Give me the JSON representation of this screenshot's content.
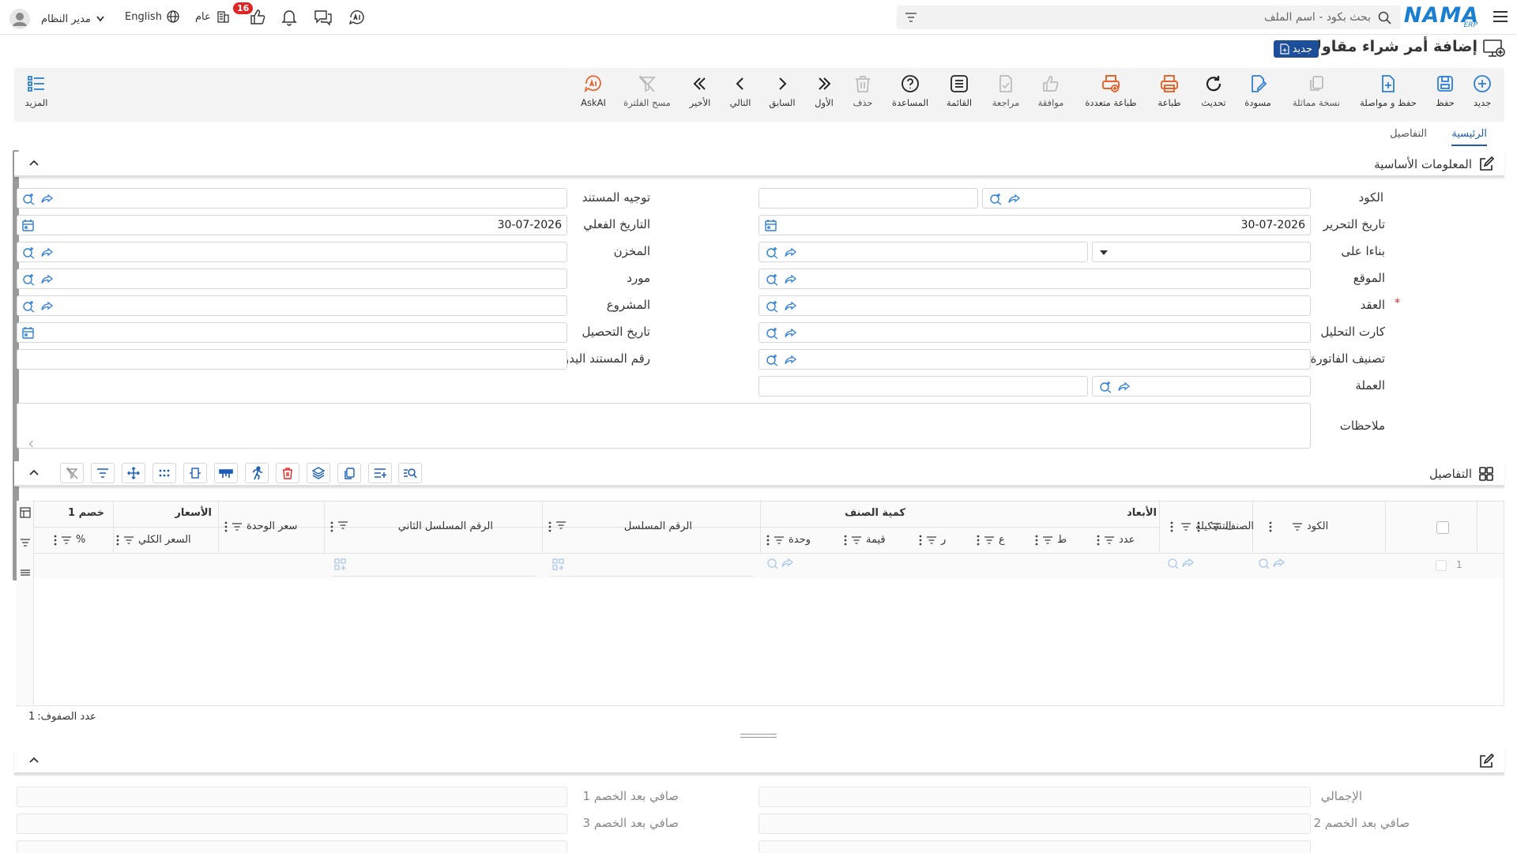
{
  "topbar": {
    "logo_text": "NAMA",
    "logo_sub": "ERP",
    "search_placeholder": "بحث بكود - اسم الملف",
    "user_name": "مدير النظام",
    "language": "English",
    "general_label": "عام",
    "notification_count": "16"
  },
  "page": {
    "title": "إضافة أمر شراء مقاولات",
    "badge": "جديد"
  },
  "toolbar": {
    "new": "جديد",
    "save": "حفظ",
    "save_continue": "حفظ و مواصلة",
    "copy": "نسخة مماثلة",
    "draft": "مسودة",
    "refresh": "تحديث",
    "print": "طباعة",
    "multi_print": "طباعة متعددة",
    "approve": "موافقة",
    "review": "مراجعة",
    "list": "القائمة",
    "help": "المساعدة",
    "delete": "حذف",
    "first": "الأول",
    "previous": "السابق",
    "next": "التالي",
    "last": "الأخير",
    "clear_filter": "مسح الفلترة",
    "askai": "AskAI",
    "more": "المزيد"
  },
  "tabs": {
    "main": "الرئيسية",
    "details": "التفاصيل"
  },
  "basic_info": {
    "title": "المعلومات الأساسية",
    "labels": {
      "code": "الكود",
      "edit_date": "تاريخ التحرير",
      "based_on": "بناءا على",
      "site": "الموقع",
      "contract": "العقد",
      "analysis_card": "كارت التحليل",
      "invoice_class": "تصنيف الفاتورة",
      "currency": "العملة",
      "notes": "ملاحظات",
      "doc_direction": "توجيه المستند",
      "actual_date": "التاريخ الفعلي",
      "warehouse": "المخزن",
      "supplier": "مورد",
      "project": "المشروع",
      "collection_date": "تاريخ التحصيل",
      "manual_doc_no": "رقم المستند اليدوي"
    },
    "values": {
      "edit_date": "30-07-2026",
      "actual_date": "30-07-2026"
    },
    "required_mark": "*"
  },
  "details": {
    "title": "التفاصيل",
    "groups": {
      "dimensions": "الأبعاد",
      "item_qty": "كمية الصنف",
      "prices": "الأسعار",
      "discount1": "خصم 1"
    },
    "columns": {
      "code": "الكود",
      "item": "الصنف",
      "config": "التشكيلة",
      "count": "عدد",
      "t": "ط",
      "a": "ع",
      "r": "ر",
      "value": "قيمة",
      "unit": "وحدة",
      "serial": "الرقم المسلسل",
      "serial2": "الرقم المسلسل الثاني",
      "unit_price": "سعر الوحدة",
      "total_price": "السعر الكلي",
      "percent": "%"
    },
    "row_number": "1",
    "row_count_label": "عدد الصفوف:",
    "row_count": "1"
  },
  "totals": {
    "total": "الإجمالي",
    "net_after_disc1": "صافي بعد الخصم 1",
    "net_after_disc2": "صافي بعد الخصم 2",
    "net_after_disc3": "صافي بعد الخصم 3"
  }
}
